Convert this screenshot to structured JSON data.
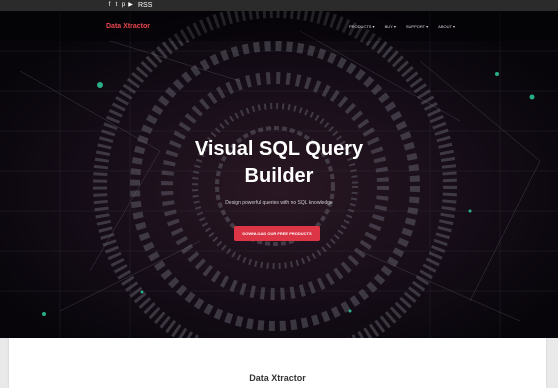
{
  "topbar": {
    "social_icons": [
      "facebook-icon",
      "twitter-icon",
      "pinterest-icon",
      "youtube-icon"
    ],
    "rss_label": "RSS"
  },
  "nav": {
    "brand": "Data Xtractor",
    "menu": [
      {
        "label": "PRODUCTS ▾"
      },
      {
        "label": "BUY ▾"
      },
      {
        "label": "SUPPORT ▾"
      },
      {
        "label": "ABOUT ▾"
      }
    ]
  },
  "hero": {
    "headline_line1": "Visual SQL Query",
    "headline_line2": "Builder",
    "subtitle": "Design powerful queries with no SQL knowledge",
    "cta": "DOWNLOAD OUR FREE PRODUCTS"
  },
  "section": {
    "title": "Data Xtractor"
  },
  "colors": {
    "brand": "#e8474f",
    "cta": "#dc3545",
    "topbar": "#2b2b2b"
  }
}
